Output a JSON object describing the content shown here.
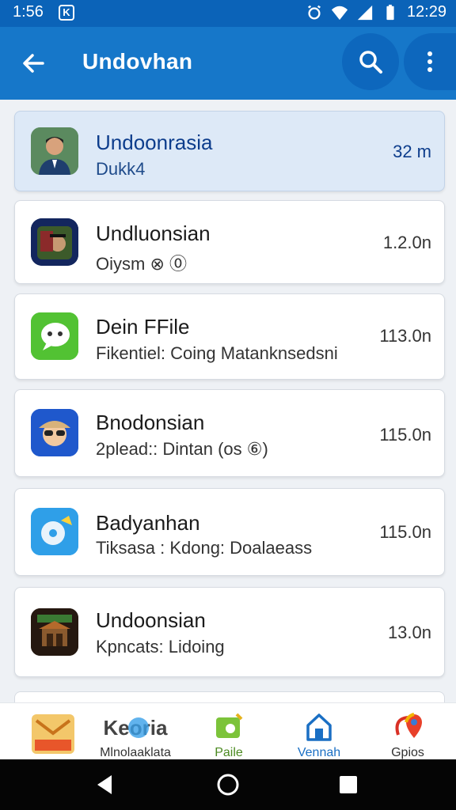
{
  "status_bar": {
    "time_left": "1:56",
    "time_right": "12:29"
  },
  "app_bar": {
    "title": "Undovhan"
  },
  "items": [
    {
      "name": "Undoonrasia",
      "subtitle": "Dukk4",
      "size": "32 m",
      "icon": "person-photo-icon",
      "selected": true
    },
    {
      "name": "Undluonsian",
      "subtitle": "Oiysm ⊗ ⓪",
      "size": "1.2.0n",
      "icon": "poster-icon",
      "selected": false
    },
    {
      "name": "Dein FFile",
      "subtitle": "Fikentiel: Coing Matanknsedsni",
      "size": "113.0n",
      "icon": "chat-bubble-icon",
      "selected": false
    },
    {
      "name": "Bnodonsian",
      "subtitle": "2plead:: Dintan (os ⑥)",
      "size": "115.0n",
      "icon": "sunglasses-face-icon",
      "selected": false
    },
    {
      "name": "Badyanhan",
      "subtitle": "Tiksasa : Kdong: Doalaeass",
      "size": "115.0n",
      "icon": "disc-icon",
      "selected": false
    },
    {
      "name": "Undoonsian",
      "subtitle": "Kpncats: Lidoing",
      "size": "13.0n",
      "icon": "building-icon",
      "selected": false
    }
  ],
  "bottom_nav": [
    {
      "label": "",
      "icon": "mail-icon"
    },
    {
      "label": "Mlnolaaklata",
      "title": "Keoria",
      "icon": "globe-search-icon"
    },
    {
      "label": "Paile",
      "icon": "folder-plus-icon"
    },
    {
      "label": "Vennah",
      "icon": "house-icon"
    },
    {
      "label": "Gpios",
      "icon": "map-pin-icon"
    }
  ],
  "colors": {
    "status_bar": "#0b63b8",
    "app_bar": "#1677c9",
    "selected_card": "#dde9f7",
    "accent": "#0d3d8c"
  }
}
